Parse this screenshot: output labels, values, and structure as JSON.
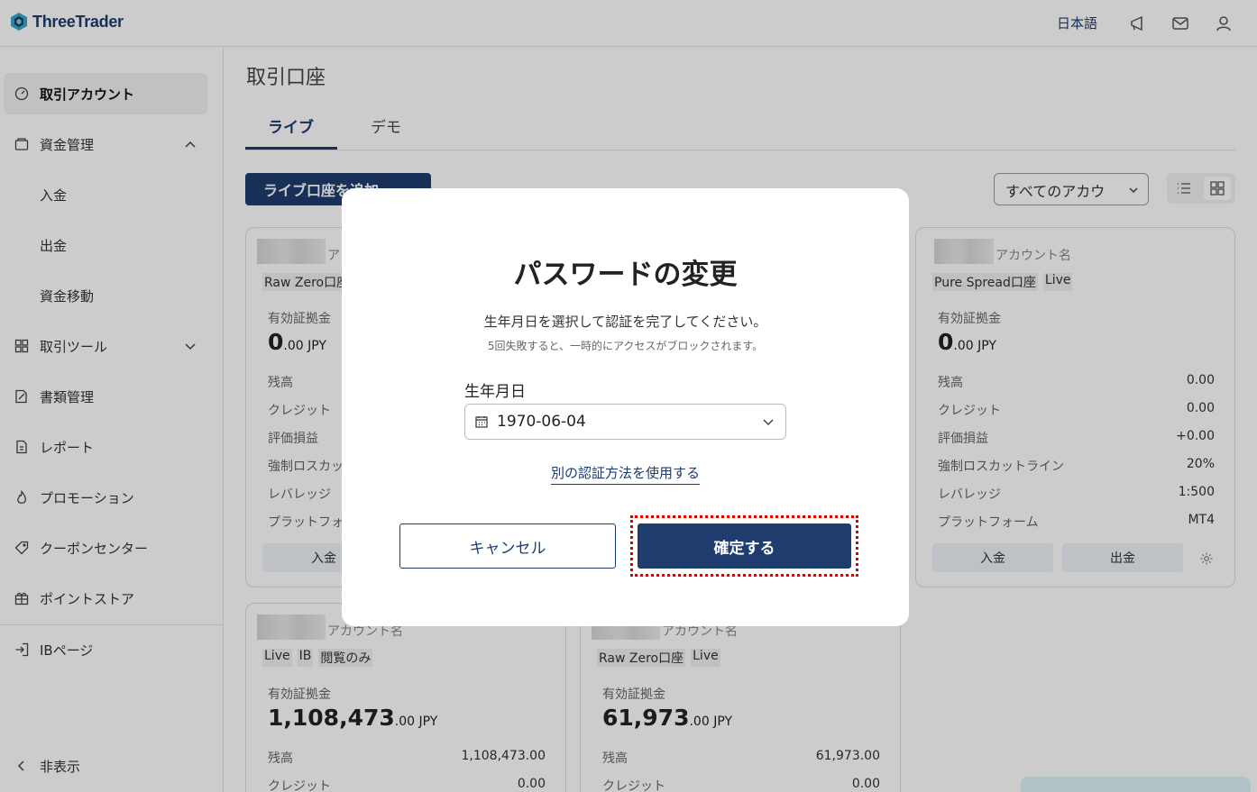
{
  "header": {
    "logo_text": "ThreeTrader",
    "language": "日本語"
  },
  "sidebar": {
    "items": [
      {
        "label": "取引アカウント"
      },
      {
        "label": "資金管理"
      },
      {
        "label": "取引ツール"
      },
      {
        "label": "書類管理"
      },
      {
        "label": "レポート"
      },
      {
        "label": "プロモーション"
      },
      {
        "label": "クーポンセンター"
      },
      {
        "label": "ポイントストア"
      },
      {
        "label": "IBページ"
      }
    ],
    "sub_items": [
      "入金",
      "出金",
      "資金移動"
    ],
    "hide_label": "非表示"
  },
  "main": {
    "title": "取引口座",
    "tabs": [
      {
        "label": "ライブ"
      },
      {
        "label": "デモ"
      }
    ],
    "add_button": "ライブ口座を追加",
    "account_filter": "すべてのアカウ",
    "card_labels": {
      "account_name": "アカウント名",
      "effective_margin": "有効証拠金",
      "balance": "残高",
      "credit": "クレジット",
      "pnl": "評価損益",
      "stopout": "強制ロスカットライン",
      "leverage": "レバレッジ",
      "platform": "プラットフォーム",
      "deposit": "入金",
      "withdraw": "出金"
    },
    "cards": [
      {
        "tags": [
          "Raw Zero口座"
        ],
        "margin_int": "0",
        "margin_dec": ".00 JPY",
        "label_short_name": "ア",
        "label_stopout_short": "強制ロスカッ",
        "label_platform_short": "プラットフォ"
      },
      {
        "tags": [
          "Pure Spread口座",
          "Live"
        ],
        "margin_int": "0",
        "margin_dec": ".00 JPY",
        "balance": "0.00",
        "credit": "0.00",
        "pnl": "+0.00",
        "stopout": "20%",
        "leverage": "1:500",
        "platform": "MT4"
      },
      {
        "tags": [
          "Live",
          "IB",
          "閲覧のみ"
        ],
        "margin_int": "1,108,473",
        "margin_dec": ".00 JPY",
        "balance": "1,108,473.00",
        "credit": "0.00"
      },
      {
        "tags": [
          "Raw Zero口座",
          "Live"
        ],
        "margin_int": "61,973",
        "margin_dec": ".00 JPY",
        "balance": "61,973.00",
        "credit": "0.00"
      }
    ]
  },
  "modal": {
    "title": "パスワードの変更",
    "description": "生年月日を選択して認証を完了してください。",
    "warning": "5回失敗すると、一時的にアクセスがブロックされます。",
    "dob_label": "生年月日",
    "dob_value": "1970-06-04",
    "alt_method": "別の認証方法を使用する",
    "cancel": "キャンセル",
    "confirm": "確定する"
  },
  "colors": {
    "brand": "#1e3c6e",
    "focus_outline": "#e00000"
  }
}
